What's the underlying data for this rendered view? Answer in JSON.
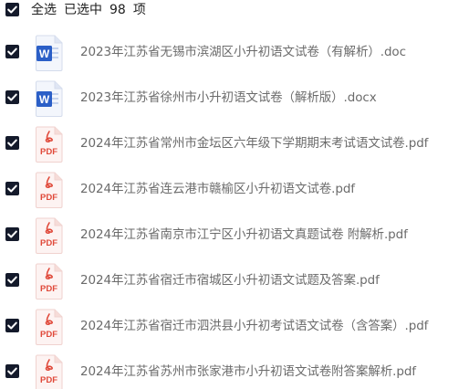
{
  "header": {
    "select_all_label": "全选",
    "selected_label": "已选中",
    "selected_count": "98",
    "unit_label": "项"
  },
  "files": [
    {
      "name": "2023年江苏省无锡市滨湖区小升初语文试卷（有解析）.doc",
      "type": "word",
      "icon_label": "W"
    },
    {
      "name": "2023年江苏省徐州市小升初语文试卷（解析版）.docx",
      "type": "word",
      "icon_label": "W"
    },
    {
      "name": "2024年江苏省常州市金坛区六年级下学期期末考试语文试卷.pdf",
      "type": "pdf",
      "icon_label": "PDF"
    },
    {
      "name": "2024年江苏省连云港市赣榆区小升初语文试卷.pdf",
      "type": "pdf",
      "icon_label": "PDF"
    },
    {
      "name": "2024年江苏省南京市江宁区小升初语文真题试卷 附解析.pdf",
      "type": "pdf",
      "icon_label": "PDF"
    },
    {
      "name": "2024年江苏省宿迁市宿城区小升初语文试题及答案.pdf",
      "type": "pdf",
      "icon_label": "PDF"
    },
    {
      "name": "2024年江苏省宿迁市泗洪县小升初考试语文试卷（含答案）.pdf",
      "type": "pdf",
      "icon_label": "PDF"
    },
    {
      "name": "2024年江苏省苏州市张家港市小升初语文试卷附答案解析.pdf",
      "type": "pdf",
      "icon_label": "PDF"
    }
  ],
  "colors": {
    "checkbox": "#141a2b",
    "word_blue": "#2b5fc7",
    "pdf_red": "#e0493a",
    "text_gray": "#6b6b6b"
  }
}
